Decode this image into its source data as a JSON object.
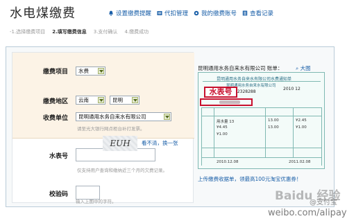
{
  "header": {
    "title": "水电煤缴费",
    "links": [
      {
        "label": "设置缴费提醒",
        "icon": "bell-icon"
      },
      {
        "label": "代扣管理",
        "icon": "card-icon"
      },
      {
        "label": "我的缴费账号",
        "icon": "gear-icon"
      },
      {
        "label": "查看记录",
        "icon": "list-icon"
      }
    ]
  },
  "steps": [
    "-1.选择缴费项目",
    "2.填写缴费信息",
    "3.支付确认",
    "4.缴费成功"
  ],
  "form": {
    "item_label": "缴费项目",
    "item_value": "水费",
    "region_label": "缴费地区",
    "province_value": "云南",
    "city_value": "昆明",
    "company_label": "收费单位",
    "company_value": "昆明通用水务自来水有限公司",
    "company_hint": "请至光大银行网点柜台补打发票。",
    "meter_label": "水表号",
    "meter_value": "",
    "meter_hint": "仅支持用户查询和缴纳近三个月的欠费记录。",
    "captcha_label": "校验码",
    "captcha_value": "",
    "captcha_image_text": "EUH",
    "captcha_refresh": "看不清，换一张",
    "captcha_hint": "输入上图中的字符。"
  },
  "sample": {
    "caption": "昆明通用水务自来水有限公司 账单：",
    "zoom": "大图",
    "bill_title": "昆明通用水务自来水有限公司水费通知单",
    "bill_sub": "昆明通用水务自来水有限公司",
    "bill_date": "2010 12",
    "bill_number": "32328288",
    "meter_tag": "水表号",
    "bill_due": "2010.12.08",
    "bill_end": "2011.02.08",
    "upload_link": "上传缴费收据单，领最高100元淘宝优惠券！"
  },
  "watermarks": {
    "baidu": "Baidu 经验",
    "alipay": "@支付宝",
    "weibo": "weibo.com/alipay"
  },
  "colors": {
    "link": "#1a5fa8",
    "accent_red": "#c8102e",
    "form_shade": "#fcf3e6"
  }
}
